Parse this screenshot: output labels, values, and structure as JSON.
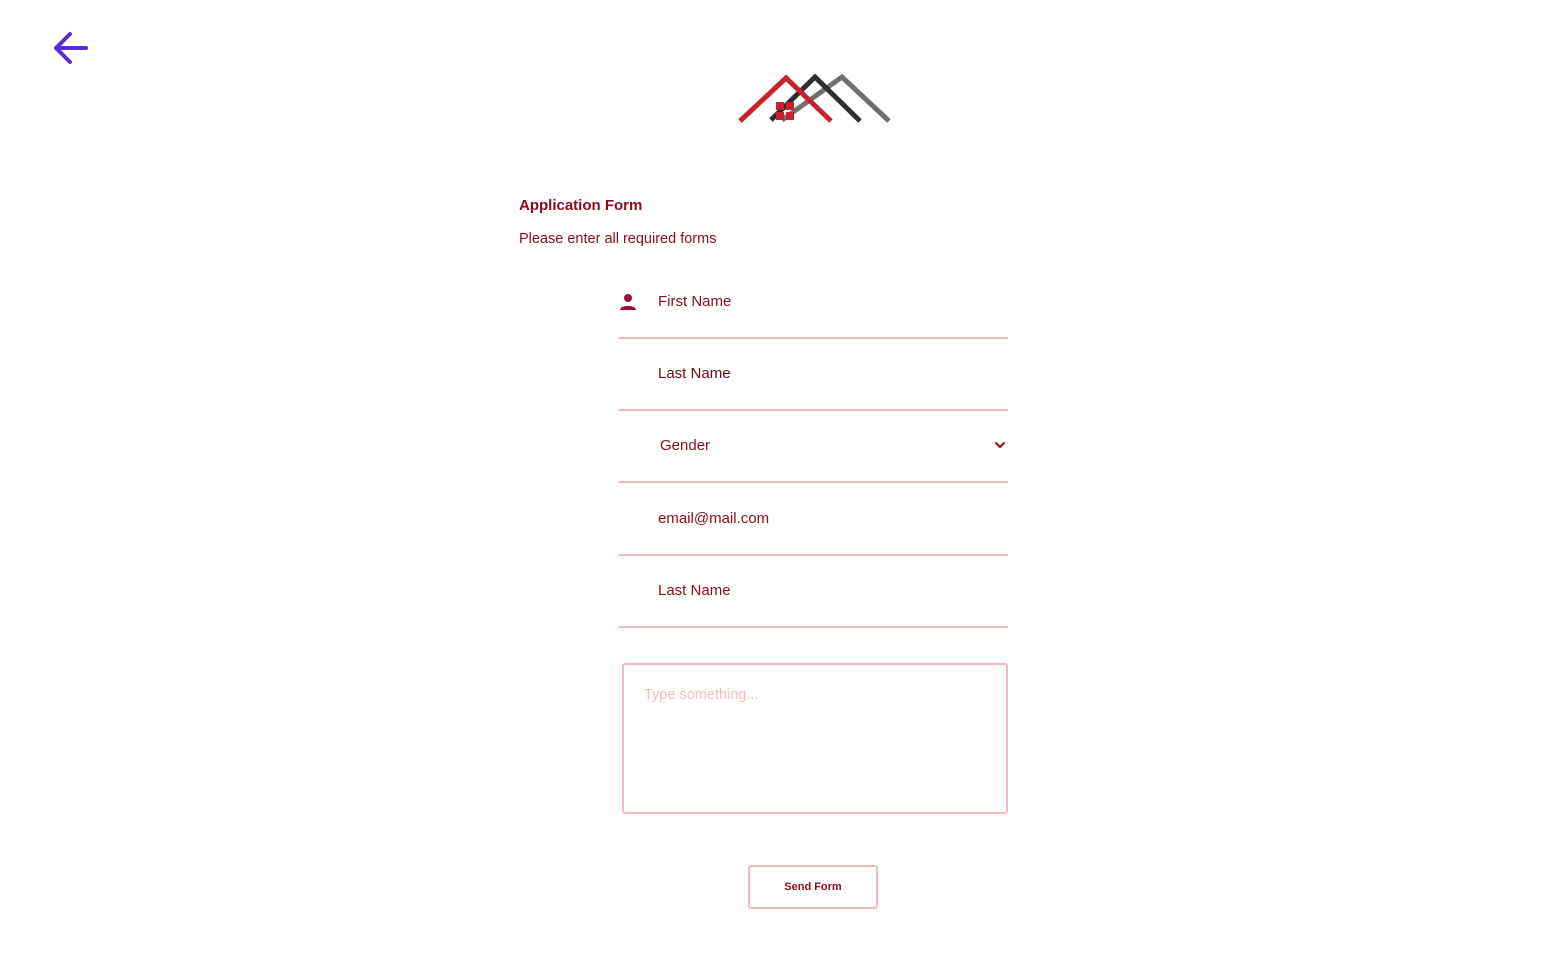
{
  "nav": {
    "back_icon": "arrow-left-icon",
    "back_color": "#5b2be0"
  },
  "logo": {
    "icon": "house-roofs-logo"
  },
  "form": {
    "title": "Application Form",
    "subtitle": "Please enter all required forms",
    "fields": {
      "first_name": {
        "placeholder": "First Name",
        "icon": "person-icon"
      },
      "last_name": {
        "value": "Last Name"
      },
      "gender": {
        "selected": "Gender",
        "icon": "chevron-down-icon"
      },
      "email": {
        "placeholder": "email@mail.com"
      },
      "last_name_2": {
        "placeholder": "Last Name"
      }
    },
    "message": {
      "placeholder": "Type something..."
    },
    "submit_label": "Send Form"
  },
  "colors": {
    "accent": "#8b0d1c",
    "border": "#f4bcc0",
    "back_arrow": "#5b2be0",
    "logo_red": "#c8202c",
    "logo_dark": "#2e2e2e",
    "logo_gray": "#6f6f6f"
  }
}
